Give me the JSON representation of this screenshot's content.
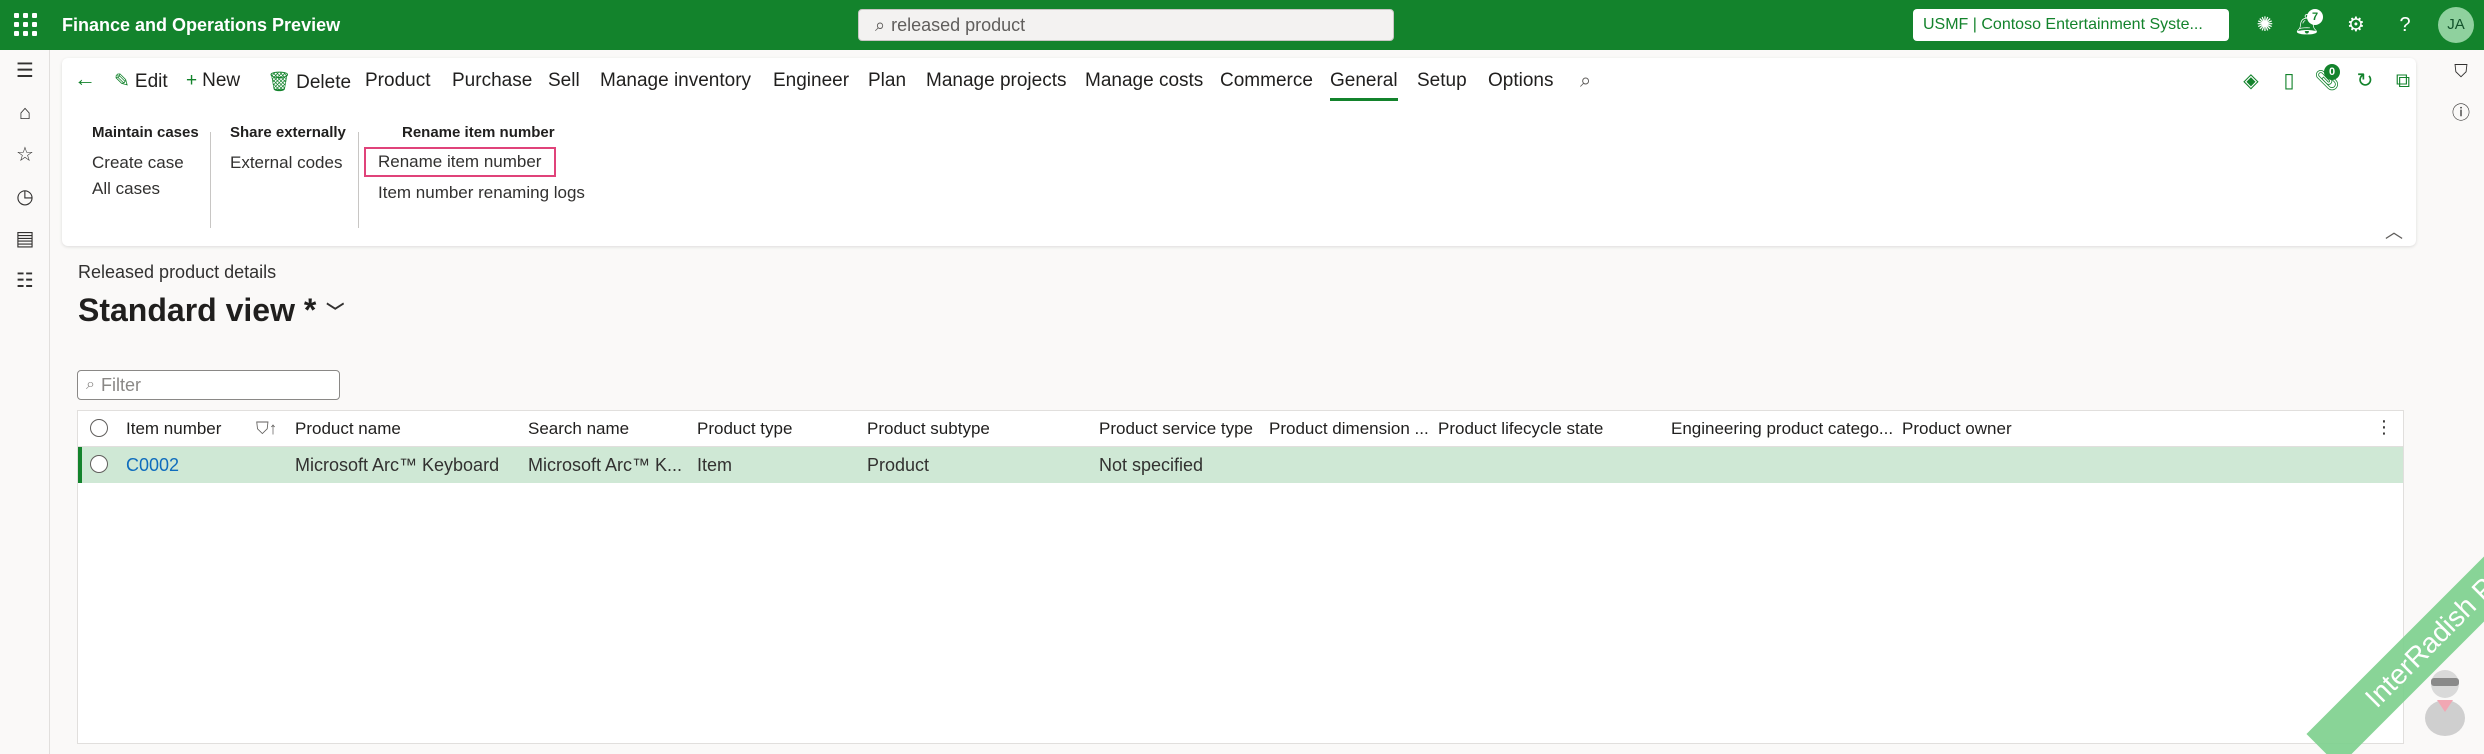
{
  "topbar": {
    "app_title": "Finance and Operations Preview",
    "search_value": "released product",
    "company": "USMF | Contoso Entertainment Syste...",
    "notifications_count": "7",
    "avatar_initials": "JA",
    "help_label": "?"
  },
  "action_pane": {
    "edit": "Edit",
    "new": "New",
    "delete": "Delete",
    "tabs": [
      "Product",
      "Purchase",
      "Sell",
      "Manage inventory",
      "Engineer",
      "Plan",
      "Manage projects",
      "Manage costs",
      "Commerce",
      "General",
      "Setup",
      "Options"
    ],
    "active_tab": "General",
    "attach_count": "0",
    "groups": [
      {
        "title": "Maintain cases",
        "items": [
          "Create case",
          "All cases"
        ]
      },
      {
        "title": "Share externally",
        "items": [
          "External codes"
        ]
      },
      {
        "title": "Rename item number",
        "items": [
          "Rename item number",
          "Item number renaming logs"
        ]
      }
    ]
  },
  "page": {
    "caption": "Released product details",
    "view_title": "Standard view *",
    "filter_placeholder": "Filter"
  },
  "grid": {
    "columns": [
      "Item number",
      "Product name",
      "Search name",
      "Product type",
      "Product subtype",
      "Product service type",
      "Product dimension ...",
      "Product lifecycle state",
      "Engineering product catego...",
      "Product owner"
    ],
    "rows": [
      {
        "item_number": "C0002",
        "product_name": "Microsoft Arc™ Keyboard",
        "search_name": "Microsoft Arc™ K...",
        "product_type": "Item",
        "product_subtype": "Product",
        "product_service_type": "Not specified"
      }
    ]
  },
  "watermark": "InterRadish PEAP",
  "colors": {
    "brand": "#13832c",
    "highlight": "#e0437a",
    "link": "#0f6cbd"
  }
}
